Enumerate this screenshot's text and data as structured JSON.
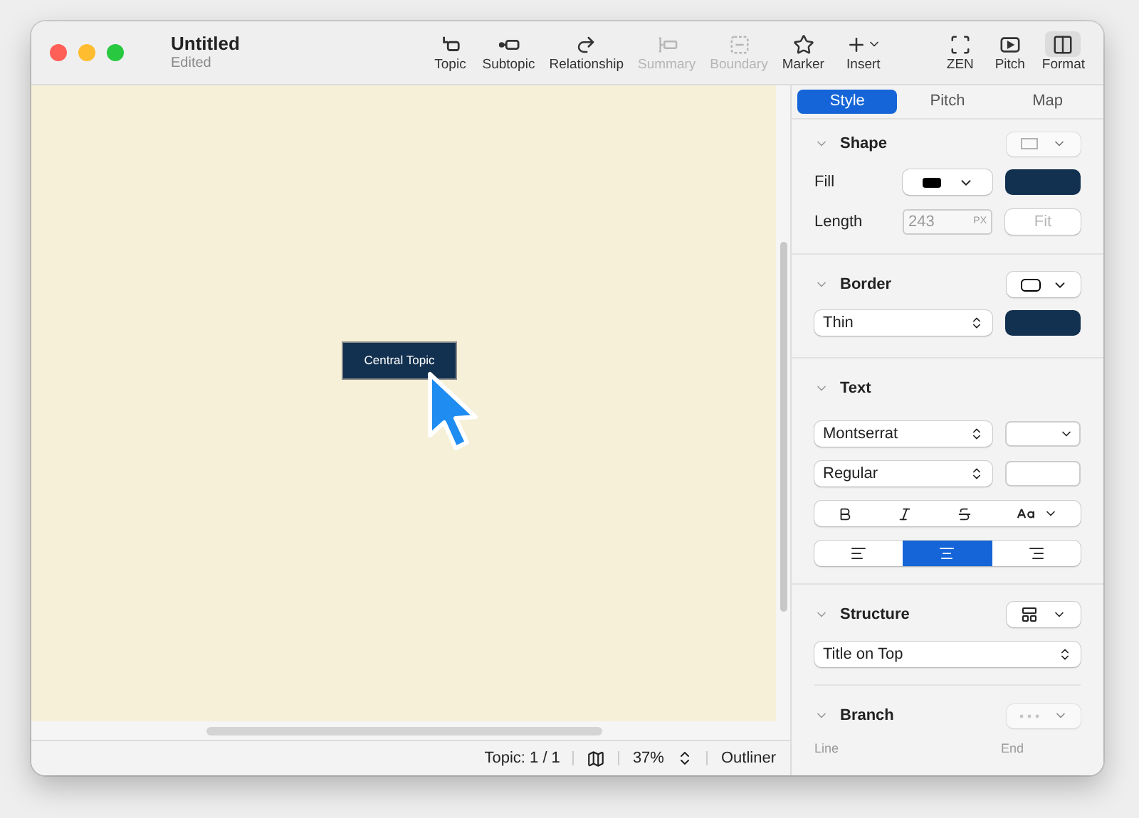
{
  "window": {
    "title": "Untitled",
    "subtitle": "Edited"
  },
  "toolbar": [
    {
      "kind": "topic",
      "label": "Topic",
      "disabled": false,
      "selected": false
    },
    {
      "kind": "subtopic",
      "label": "Subtopic",
      "disabled": false,
      "selected": false
    },
    {
      "kind": "relationship",
      "label": "Relationship",
      "disabled": false,
      "selected": false
    },
    {
      "kind": "summary",
      "label": "Summary",
      "disabled": true,
      "selected": false
    },
    {
      "kind": "boundary",
      "label": "Boundary",
      "disabled": true,
      "selected": false
    },
    {
      "kind": "marker",
      "label": "Marker",
      "disabled": false,
      "selected": false
    },
    {
      "kind": "insert",
      "label": "Insert",
      "disabled": false,
      "selected": false
    },
    {
      "kind": "zen",
      "label": "ZEN",
      "disabled": false,
      "selected": false
    },
    {
      "kind": "pitch",
      "label": "Pitch",
      "disabled": false,
      "selected": false
    },
    {
      "kind": "format",
      "label": "Format",
      "disabled": false,
      "selected": true
    }
  ],
  "canvas": {
    "topic": {
      "label": "Central Topic"
    }
  },
  "status_bar": {
    "topic_count": "Topic: 1 / 1",
    "zoom": "37%",
    "outliner": "Outliner"
  },
  "panel": {
    "tabs": [
      {
        "label": "Style",
        "selected": true
      },
      {
        "label": "Pitch",
        "selected": false
      },
      {
        "label": "Map",
        "selected": false
      }
    ],
    "shape": {
      "title": "Shape",
      "fill_label": "Fill",
      "length_label": "Length",
      "length_value": "243",
      "length_unit": "PX",
      "fit": "Fit",
      "fit_disabled": true
    },
    "border": {
      "title": "Border",
      "line": "Thin"
    },
    "text": {
      "title": "Text",
      "font": "Montserrat",
      "weight": "Regular",
      "align": [
        {
          "kind": "left",
          "selected": false
        },
        {
          "kind": "center",
          "selected": true
        },
        {
          "kind": "right",
          "selected": false
        }
      ]
    },
    "structure": {
      "title": "Structure",
      "value": "Title on Top"
    },
    "branch": {
      "title": "Branch",
      "line_label": "Line",
      "end_label": "End"
    }
  }
}
